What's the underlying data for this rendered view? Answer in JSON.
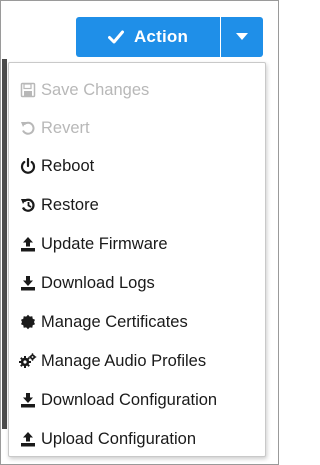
{
  "action_button": {
    "label": "Action",
    "icon": "checkmark-icon",
    "caret_icon": "caret-down-icon",
    "color": "#1f8fe8"
  },
  "menu": {
    "items": [
      {
        "label": "Save Changes",
        "icon": "floppy-disk-icon",
        "disabled": true
      },
      {
        "label": "Revert",
        "icon": "undo-icon",
        "disabled": true
      },
      {
        "label": "Reboot",
        "icon": "power-icon",
        "disabled": false
      },
      {
        "label": "Restore",
        "icon": "restore-icon",
        "disabled": false
      },
      {
        "label": "Update Firmware",
        "icon": "upload-icon",
        "disabled": false
      },
      {
        "label": "Download Logs",
        "icon": "download-icon",
        "disabled": false
      },
      {
        "label": "Manage Certificates",
        "icon": "certificate-icon",
        "disabled": false
      },
      {
        "label": "Manage Audio Profiles",
        "icon": "gears-icon",
        "disabled": false
      },
      {
        "label": "Download Configuration",
        "icon": "download-icon",
        "disabled": false
      },
      {
        "label": "Upload Configuration",
        "icon": "upload-icon",
        "disabled": false
      }
    ]
  }
}
